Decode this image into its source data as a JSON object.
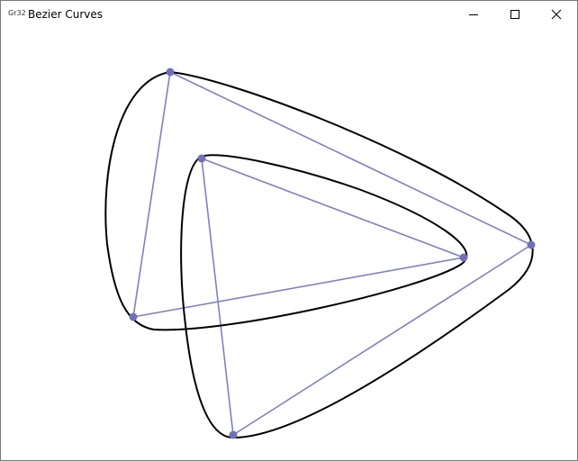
{
  "window": {
    "title": "Bezier Curves",
    "app_icon_label": "Gr32"
  },
  "controls": {
    "minimize": "minimize-icon",
    "maximize": "maximize-icon",
    "close": "close-icon"
  },
  "colors": {
    "curve": "#000000",
    "control_polygon": "#8080c0",
    "control_point": "#7070b8",
    "background": "#ffffff"
  }
}
